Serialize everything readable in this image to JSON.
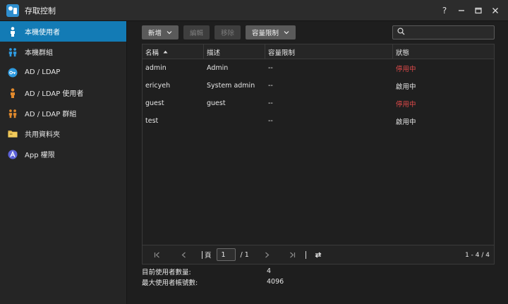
{
  "window": {
    "title": "存取控制"
  },
  "sidebar": {
    "items": [
      {
        "label": "本機使用者",
        "icon": "user-icon",
        "active": true
      },
      {
        "label": "本機群組",
        "icon": "group-icon",
        "active": false
      },
      {
        "label": "AD / LDAP",
        "icon": "key-icon",
        "active": false
      },
      {
        "label": "AD / LDAP 使用者",
        "icon": "domain-user-icon",
        "active": false
      },
      {
        "label": "AD / LDAP 群組",
        "icon": "domain-group-icon",
        "active": false
      },
      {
        "label": "共用資料夾",
        "icon": "folder-icon",
        "active": false
      },
      {
        "label": "App 權限",
        "icon": "app-permission-icon",
        "active": false
      }
    ]
  },
  "toolbar": {
    "create_label": "新增",
    "edit_label": "編輯",
    "delete_label": "移除",
    "quota_label": "容量限制"
  },
  "search": {
    "placeholder": ""
  },
  "table": {
    "headers": [
      "名稱",
      "描述",
      "容量限制",
      "狀態"
    ],
    "rows": [
      {
        "name": "admin",
        "description": "Admin",
        "quota": "--",
        "status": "停用中",
        "disabled": true
      },
      {
        "name": "ericyeh",
        "description": "System admin",
        "quota": "--",
        "status": "啟用中",
        "disabled": false
      },
      {
        "name": "guest",
        "description": "guest",
        "quota": "--",
        "status": "停用中",
        "disabled": true
      },
      {
        "name": "test",
        "description": "",
        "quota": "--",
        "status": "啟用中",
        "disabled": false
      }
    ]
  },
  "pager": {
    "page_label": "頁",
    "current_page": "1",
    "total_pages": "/ 1",
    "range": "1 - 4 / 4"
  },
  "stats": {
    "current_users_label": "目前使用者數量:",
    "current_users_value": "4",
    "max_users_label": "最大使用者帳號數:",
    "max_users_value": "4096"
  },
  "colors": {
    "accent": "#137bb5",
    "disabled_status": "#e24a4a",
    "user_icon": "#2f9be0",
    "domain_icon": "#e0892c"
  }
}
